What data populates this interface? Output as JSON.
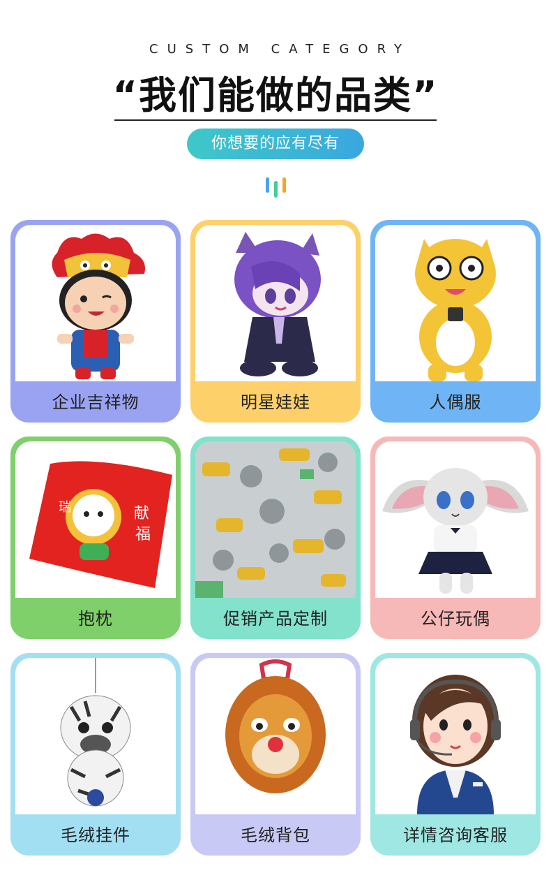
{
  "header": {
    "subtitle_en": "CUSTOM CATEGORY",
    "title": "“我们能做的品类”",
    "pill": "你想要的应有尽有"
  },
  "categories": [
    {
      "label": "企业吉祥物",
      "color": "#9aa3f2"
    },
    {
      "label": "明星娃娃",
      "color": "#fdd06a"
    },
    {
      "label": "人偶服",
      "color": "#6fb5f5"
    },
    {
      "label": "抱枕",
      "color": "#7fcf6a"
    },
    {
      "label": "促销产品定制",
      "color": "#82e2cc"
    },
    {
      "label": "公仔玩偶",
      "color": "#f7b8b8"
    },
    {
      "label": "毛绒挂件",
      "color": "#a3dff3"
    },
    {
      "label": "毛绒背包",
      "color": "#c9c9f5"
    },
    {
      "label": "详情咨询客服",
      "color": "#9ee7e2"
    }
  ]
}
